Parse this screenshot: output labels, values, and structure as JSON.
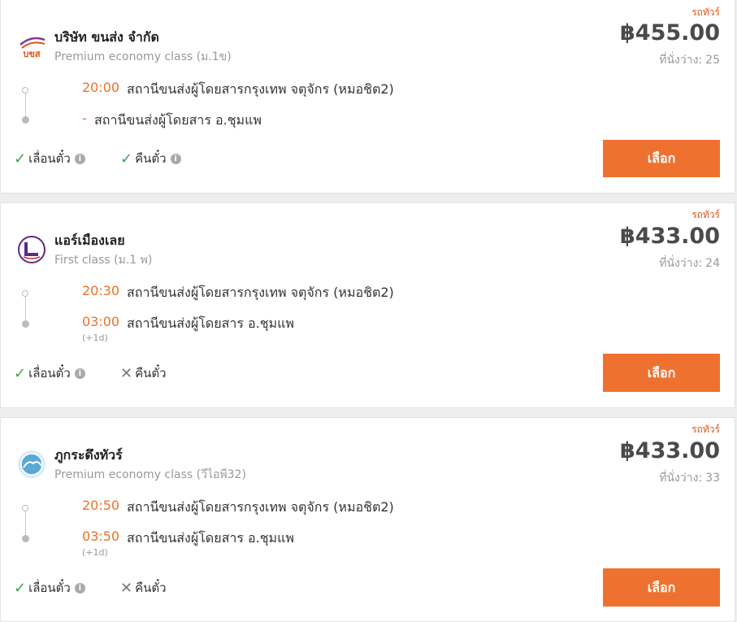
{
  "results": [
    {
      "tag": "รถทัวร์",
      "operator": "บริษัท ขนส่ง จำกัด",
      "class": "Premium economy class (ม.1ข)",
      "price": "฿455.00",
      "seats_label": "ที่นั่งว่าง:",
      "seats": "25",
      "depart_time": "20:00",
      "depart_station": "สถานีขนส่งผู้โดยสารกรุงเทพ จตุจักร (หมอชิต2)",
      "arrive_time": "-",
      "arrive_station": "สถานีขนส่งผู้โดยสาร อ.ชุมแพ",
      "reschedule_label": "เลื่อนตั๋ว",
      "refund_label": "คืนตั๋ว",
      "select_label": "เลือก"
    },
    {
      "tag": "รถทัวร์",
      "operator": "แอร์เมืองเลย",
      "class": "First class (ม.1 พ)",
      "price": "฿433.00",
      "seats_label": "ที่นั่งว่าง:",
      "seats": "24",
      "depart_time": "20:30",
      "depart_station": "สถานีขนส่งผู้โดยสารกรุงเทพ จตุจักร (หมอชิต2)",
      "arrive_time": "03:00",
      "arrive_station": "สถานีขนส่งผู้โดยสาร อ.ชุมแพ",
      "next_day": "(+1d)",
      "reschedule_label": "เลื่อนตั๋ว",
      "refund_label": "คืนตั๋ว",
      "select_label": "เลือก"
    },
    {
      "tag": "รถทัวร์",
      "operator": "ภูกระดึงทัวร์",
      "class": "Premium economy class (วีไอพี32)",
      "price": "฿433.00",
      "seats_label": "ที่นั่งว่าง:",
      "seats": "33",
      "depart_time": "20:50",
      "depart_station": "สถานีขนส่งผู้โดยสารกรุงเทพ จตุจักร (หมอชิต2)",
      "arrive_time": "03:50",
      "arrive_station": "สถานีขนส่งผู้โดยสาร อ.ชุมแพ",
      "next_day": "(+1d)",
      "reschedule_label": "เลื่อนตั๋ว",
      "refund_label": "คืนตั๋ว",
      "select_label": "เลือก"
    }
  ],
  "logo_1_text": "บขส",
  "icons": {
    "check": "check-icon",
    "cross": "cross-icon",
    "info": "info-icon"
  },
  "colors": {
    "accent": "#ef7130",
    "time": "#f07025",
    "check": "#3fa348"
  }
}
